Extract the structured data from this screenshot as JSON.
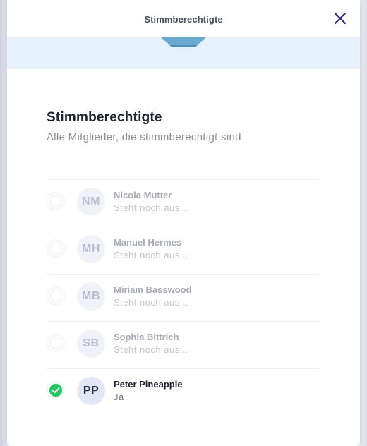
{
  "header": {
    "title": "Stimmberechtigte",
    "close_icon": "close-icon",
    "accent_color": "#2b2f7a"
  },
  "banner": {
    "background": "#e5f1fb",
    "shape_color": "#5a9fc6"
  },
  "main": {
    "title": "Stimmberechtigte",
    "subtitle": "Alle Mitglieder, die stimmberechtigt sind"
  },
  "members": [
    {
      "initials": "NM",
      "name": "Nicola Mutter",
      "status": "Steht noch aus...",
      "checked": false
    },
    {
      "initials": "MH",
      "name": "Manuel Hermes",
      "status": "Steht noch aus...",
      "checked": false
    },
    {
      "initials": "MB",
      "name": "Miriam Basswood",
      "status": "Steht noch aus...",
      "checked": false
    },
    {
      "initials": "SB",
      "name": "Sophia Bittrich",
      "status": "Steht noch aus...",
      "checked": false
    },
    {
      "initials": "PP",
      "name": "Peter Pineapple",
      "status": "Ja",
      "checked": true
    }
  ],
  "colors": {
    "check_green": "#22c55e"
  }
}
